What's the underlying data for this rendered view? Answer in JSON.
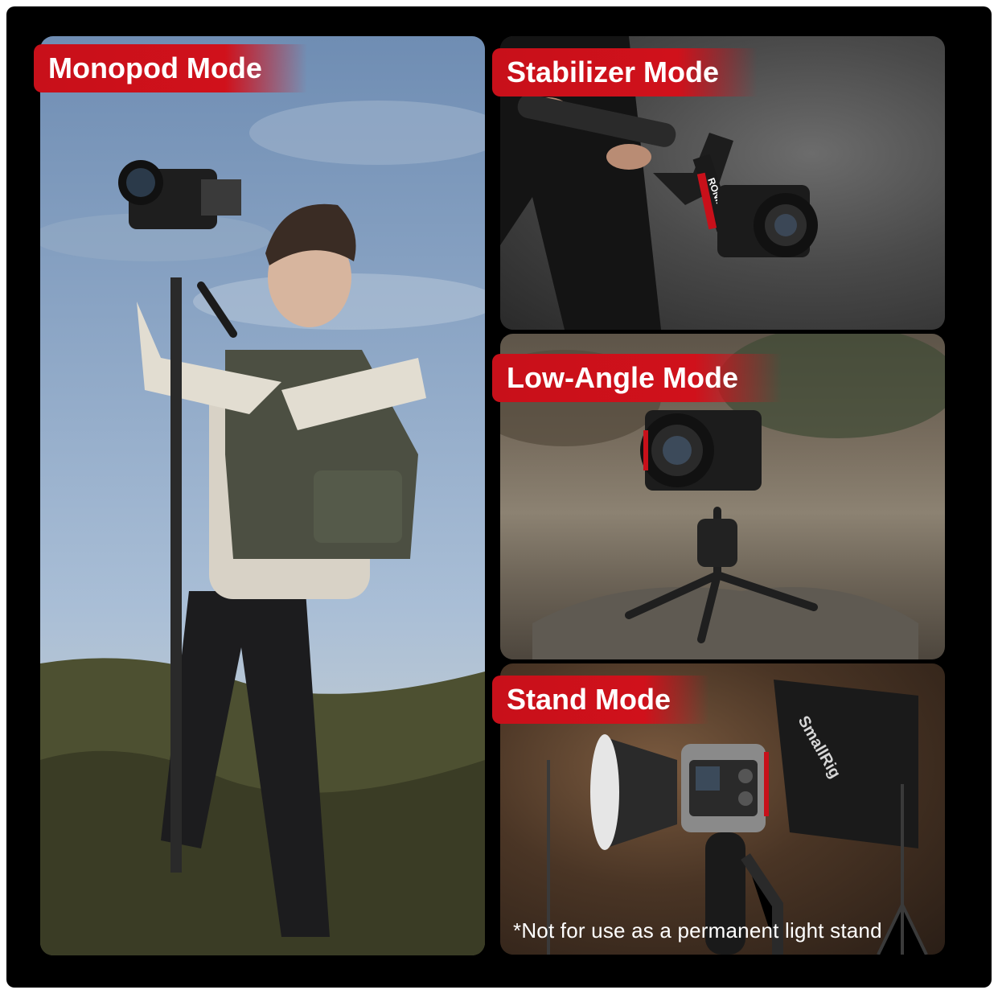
{
  "modes": {
    "monopod": {
      "title": "Monopod Mode"
    },
    "stabilizer": {
      "title": "Stabilizer Mode",
      "gimbal_text": "RONIN"
    },
    "low_angle": {
      "title": "Low-Angle Mode"
    },
    "stand": {
      "title": "Stand Mode",
      "note": "*Not for use as a permanent light stand",
      "brand_text": "SmallRig"
    }
  },
  "colors": {
    "accent": "#d0111b",
    "background": "#000000",
    "text": "#ffffff"
  }
}
